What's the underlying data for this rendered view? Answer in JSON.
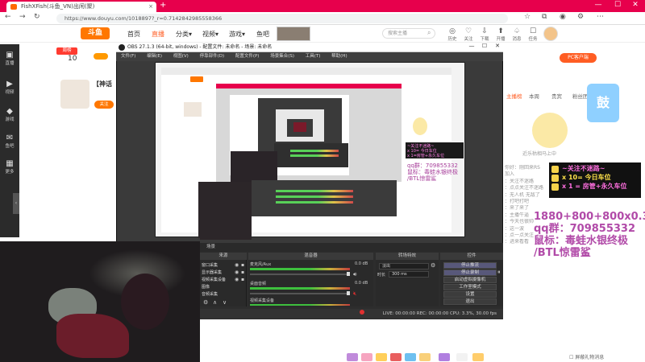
{
  "browser": {
    "tab_title": "FishXFish(斗鱼_VN)出闲(聚)",
    "new_tab_symbol": "+",
    "url": "https://www.douyu.com/1018897?_r=0.7142842985558366",
    "win_min": "—",
    "win_max": "☐",
    "win_close": "✕"
  },
  "site": {
    "logo_text": "斗鱼",
    "nav": [
      "首页",
      "直播",
      "分类▾",
      "视频▾",
      "游戏▾",
      "鱼吧"
    ],
    "nav_active_index": 1,
    "search_placeholder": "搜索主播",
    "header_icons": [
      {
        "icon": "rank-icon",
        "glyph": "◎",
        "label": "历史"
      },
      {
        "icon": "follow-icon",
        "glyph": "♡",
        "label": "关注"
      },
      {
        "icon": "download-icon",
        "glyph": "⇩",
        "label": "下载"
      },
      {
        "icon": "upload-icon",
        "glyph": "⬆",
        "label": "开播"
      },
      {
        "icon": "bell-icon",
        "glyph": "♤",
        "label": "消息"
      },
      {
        "icon": "gift-icon",
        "glyph": "☐",
        "label": "任务"
      }
    ],
    "left_nav": [
      {
        "icon": "live-icon",
        "glyph": "▣",
        "label": "直播"
      },
      {
        "icon": "video-icon",
        "glyph": "▶",
        "label": "视频"
      },
      {
        "icon": "game-icon",
        "glyph": "◆",
        "label": "游戏"
      },
      {
        "icon": "fishbar-icon",
        "glyph": "✉",
        "label": "鱼吧"
      },
      {
        "icon": "more-icon",
        "glyph": "▦",
        "label": "更多"
      }
    ],
    "rank_badge": "周榜",
    "rank_value": "10",
    "rank_badge2": "",
    "streamer_title": "【神话",
    "follow_label": "关注",
    "pc_client_label": "PC客户端",
    "right_tabs": [
      "主播榜",
      "本周",
      "贵宾",
      "粉丝团"
    ],
    "right_tab_active": 0,
    "mascot_caption": "近乐枯相马上中",
    "blue_badge": "鼓",
    "chat_lines": [
      "你好：刚回来RS",
      "加入",
      "：关注不迷路",
      "：点点关注不迷路",
      "：无人机 无敌了",
      "：打吧打吧",
      "：来了来了",
      "：主播牛逼",
      "：今天也很帅",
      "：这一波",
      "：点一点关注",
      "：进来看看"
    ]
  },
  "obs": {
    "title": "OBS 27.1.3 (64-bit, windows) - 配置文件: 未命名 - 场景: 未命名",
    "menu": [
      "文件(F)",
      "编辑(E)",
      "视图(V)",
      "停靠部件(D)",
      "配置文件(P)",
      "场景集合(S)",
      "工具(T)",
      "帮助(H)"
    ],
    "docks": {
      "scenes": "来源",
      "mixer": "混音器",
      "transitions": "转场特效",
      "controls": "控件"
    },
    "sources": [
      "窗口采集",
      "显示器采集",
      "视频采集设备",
      "图像",
      "音频采集"
    ],
    "mixer_channels": [
      {
        "label": "麦克风/Aux",
        "volume": "0.0 dB",
        "muted": false,
        "level_pct": 100
      },
      {
        "label": "桌面音频",
        "volume": "0.0 dB",
        "muted": false,
        "level_pct": 100
      },
      {
        "label": "视频采集设备",
        "volume": "0.0 dB",
        "muted": true,
        "level_pct": 100
      }
    ],
    "transition": {
      "type": "淡出",
      "duration_label": "时长",
      "duration": "300 ms"
    },
    "controls": [
      "停止推流",
      "停止录制",
      "启动虚拟摄像机",
      "工作室模式",
      "设置",
      "退出"
    ],
    "controls_active": [
      0,
      1
    ],
    "status": "LIVE: 00:00:00   REC: 00:00:00   CPU: 3.3%, 30.00 fps",
    "mini_badge": "场景"
  },
  "overlay": {
    "line1": "~关注不迷路~",
    "line2": "x 10= 今日车位",
    "line3": "x 1 = 房管+永久车位",
    "text": "1880+800+800x0.331\nqq群：709855332\n鼠标：毒蛙水银终极\n/BTL惊雷鲨",
    "nest_card": "~关注不迷路~\nx 10= 今日车位\nx 1=房管+永久车位",
    "nest_text": "qq群：709855332\n鼠标：毒蛙水银终极\n/BTL惊雷鲨"
  },
  "bottom": {
    "check_label": "屏蔽礼物消息",
    "gift_colors": [
      "#c08bdb",
      "#f6a5c0",
      "#ffcf5a",
      "#e95f5f",
      "#6ec0f0",
      "#f9d07a",
      "#b07fe0",
      "#f2f2f2",
      "#ffcd6b"
    ]
  },
  "colors": {
    "brand": "#ff7700",
    "chrome": "#e7004c",
    "accent": "#ff5d23",
    "obs_bg": "#3a3a3a"
  }
}
